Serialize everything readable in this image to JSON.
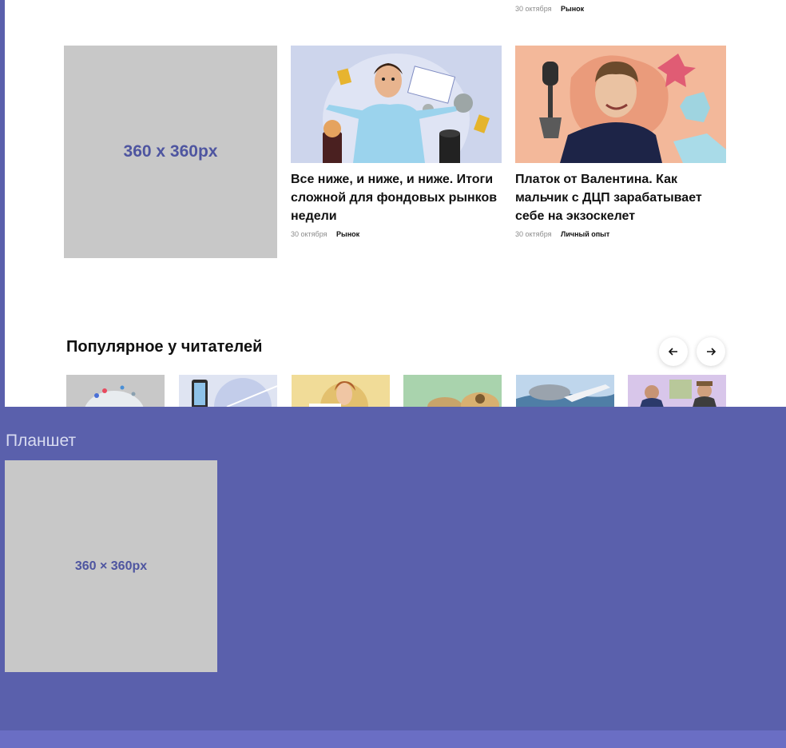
{
  "top_item": {
    "date": "30 октября",
    "tag": "Рынок"
  },
  "placeholder_large": {
    "label": "360 x 360px"
  },
  "cards": [
    {
      "title": "Все ниже, и ниже, и ниже. Итоги сложной для фондовых рынков недели",
      "date": "30 октября",
      "tag": "Рынок",
      "image_icon": "man-shrugging-with-coins-icon"
    },
    {
      "title": "Платок от Валентина. Как мальчик с ДЦП зарабатывает себе на экзоскелет",
      "date": "30 октября",
      "tag": "Личный опыт",
      "image_icon": "boy-with-exoskeleton-icon"
    }
  ],
  "popular": {
    "title": "Популярное у читателей",
    "prev_icon": "arrow-left-icon",
    "next_icon": "arrow-right-icon"
  },
  "tablet": {
    "label": "Планшет",
    "placeholder_label": "360 × 360px"
  },
  "colors": {
    "background": "#5a60ac",
    "placeholder": "#c8c8c8",
    "placeholder_text": "#4e55a0"
  }
}
